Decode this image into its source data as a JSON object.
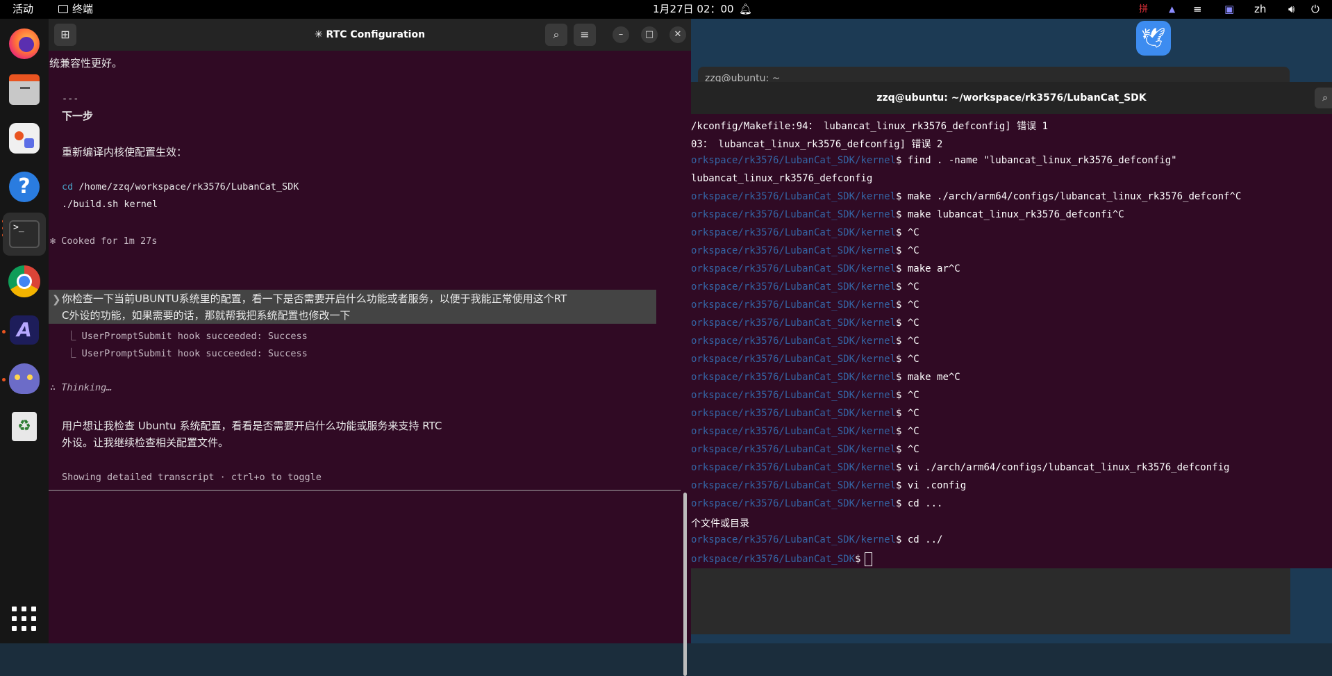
{
  "topbar": {
    "activities": "活动",
    "app_name": "终端",
    "clock": "1月27日 02：00",
    "ime_icon": "拼",
    "lang": "zh"
  },
  "dock": {
    "items": [
      "firefox-icon",
      "files-icon",
      "app-center-icon",
      "help-icon",
      "terminal-icon",
      "chrome-icon",
      "claude-icon",
      "cat-app-icon",
      "trash-icon",
      "show-apps-icon"
    ]
  },
  "left_terminal": {
    "title": "✳ RTC Configuration",
    "lines": {
      "l0": "统兼容性更好。",
      "l1": "---",
      "l2": "下一步",
      "l3": "重新编译内核使配置生效：",
      "l4_cmd": "cd",
      "l4_arg": " /home/zzq/workspace/rk3576/LubanCat_SDK",
      "l5": "./build.sh kernel",
      "l6": "✻ Cooked for 1m 27s",
      "l7": "你检查一下当前UBUNTU系统里的配置，看一下是否需要开启什么功能或者服务，以便于我能正常使用这个RT",
      "l8": "C外设的功能，如果需要的话，那就帮我把系统配置也修改一下",
      "l9": "⎿ UserPromptSubmit hook succeeded: Success",
      "l10": "⎿ UserPromptSubmit hook succeeded: Success",
      "l11": "∴ Thinking…",
      "l12": "用户想让我检查 Ubuntu 系统配置，看看是否需要开启什么功能或服务来支持 RTC",
      "l13": "外设。让我继续检查相关配置文件。",
      "footer": "Showing detailed transcript · ctrl+o to toggle"
    }
  },
  "right_terminal": {
    "bg_title": "zzq@ubuntu: ~",
    "title": "zzq@ubuntu: ~/workspace/rk3576/LubanCat_SDK",
    "lines": [
      {
        "p": "",
        "t": "/kconfig/Makefile:94： lubancat_linux_rk3576_defconfig] 错误 1"
      },
      {
        "p": "",
        "t": "03： lubancat_linux_rk3576_defconfig] 错误 2"
      },
      {
        "p": "orkspace/rk3576/LubanCat_SDK/kernel",
        "t": "$ find . -name \"lubancat_linux_rk3576_defconfig\""
      },
      {
        "p": "",
        "t": "lubancat_linux_rk3576_defconfig"
      },
      {
        "p": "orkspace/rk3576/LubanCat_SDK/kernel",
        "t": "$ make ./arch/arm64/configs/lubancat_linux_rk3576_defconf^C"
      },
      {
        "p": "orkspace/rk3576/LubanCat_SDK/kernel",
        "t": "$ make lubancat_linux_rk3576_defconfi^C"
      },
      {
        "p": "orkspace/rk3576/LubanCat_SDK/kernel",
        "t": "$ ^C"
      },
      {
        "p": "orkspace/rk3576/LubanCat_SDK/kernel",
        "t": "$ ^C"
      },
      {
        "p": "orkspace/rk3576/LubanCat_SDK/kernel",
        "t": "$ make ar^C"
      },
      {
        "p": "orkspace/rk3576/LubanCat_SDK/kernel",
        "t": "$ ^C"
      },
      {
        "p": "orkspace/rk3576/LubanCat_SDK/kernel",
        "t": "$ ^C"
      },
      {
        "p": "orkspace/rk3576/LubanCat_SDK/kernel",
        "t": "$ ^C"
      },
      {
        "p": "orkspace/rk3576/LubanCat_SDK/kernel",
        "t": "$ ^C"
      },
      {
        "p": "orkspace/rk3576/LubanCat_SDK/kernel",
        "t": "$ ^C"
      },
      {
        "p": "orkspace/rk3576/LubanCat_SDK/kernel",
        "t": "$ make me^C"
      },
      {
        "p": "orkspace/rk3576/LubanCat_SDK/kernel",
        "t": "$ ^C"
      },
      {
        "p": "orkspace/rk3576/LubanCat_SDK/kernel",
        "t": "$ ^C"
      },
      {
        "p": "orkspace/rk3576/LubanCat_SDK/kernel",
        "t": "$ ^C"
      },
      {
        "p": "orkspace/rk3576/LubanCat_SDK/kernel",
        "t": "$ ^C"
      },
      {
        "p": "orkspace/rk3576/LubanCat_SDK/kernel",
        "t": "$ vi ./arch/arm64/configs/lubancat_linux_rk3576_defconfig"
      },
      {
        "p": "orkspace/rk3576/LubanCat_SDK/kernel",
        "t": "$ vi .config"
      },
      {
        "p": "orkspace/rk3576/LubanCat_SDK/kernel",
        "t": "$ cd ..."
      },
      {
        "p": "",
        "t": "个文件或目录"
      },
      {
        "p": "orkspace/rk3576/LubanCat_SDK/kernel",
        "t": "$ cd ../"
      },
      {
        "p": "orkspace/rk3576/LubanCat_SDK",
        "t": "$"
      }
    ]
  }
}
